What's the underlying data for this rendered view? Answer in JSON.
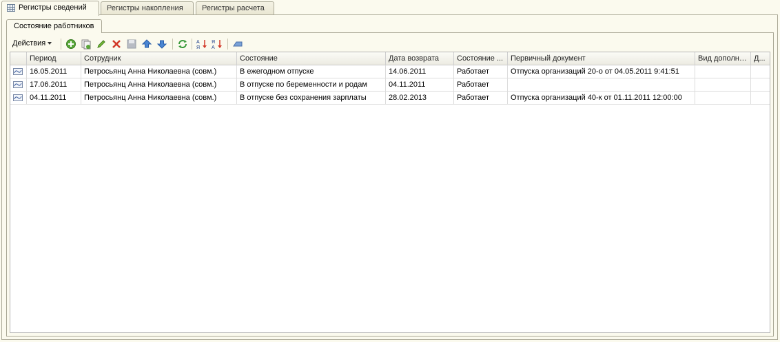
{
  "top_tabs": [
    {
      "label": "Регистры сведений",
      "active": true
    },
    {
      "label": "Регистры накопления",
      "active": false
    },
    {
      "label": "Регистры расчета",
      "active": false
    }
  ],
  "inner_tab": {
    "label": "Состояние работников"
  },
  "toolbar": {
    "actions_label": "Действия",
    "icons": [
      "add-icon",
      "copy-icon",
      "edit-icon",
      "delete-icon",
      "save-icon",
      "move-up-icon",
      "move-down-icon",
      "refresh-icon",
      "sort-asc-icon",
      "sort-desc-icon",
      "filter-icon"
    ]
  },
  "table": {
    "columns": [
      "Период",
      "Сотрудник",
      "Состояние",
      "Дата возврата",
      "Состояние ...",
      "Первичный документ",
      "Вид дополни...",
      "Д..."
    ],
    "rows": [
      [
        "16.05.2011",
        "Петросьянц Анна Николаевна (совм.)",
        "В ежегодном отпуске",
        "14.06.2011",
        "Работает",
        "Отпуска организаций 20-о от 04.05.2011 9:41:51",
        "",
        ""
      ],
      [
        "17.06.2011",
        "Петросьянц Анна Николаевна (совм.)",
        "В отпуске по беременности и родам",
        "04.11.2011",
        "Работает",
        "",
        "",
        ""
      ],
      [
        "04.11.2011",
        "Петросьянц Анна Николаевна (совм.)",
        "В отпуске без сохранения зарплаты",
        "28.02.2013",
        "Работает",
        "Отпуска организаций 40-к от 01.11.2011 12:00:00",
        "",
        ""
      ]
    ]
  }
}
